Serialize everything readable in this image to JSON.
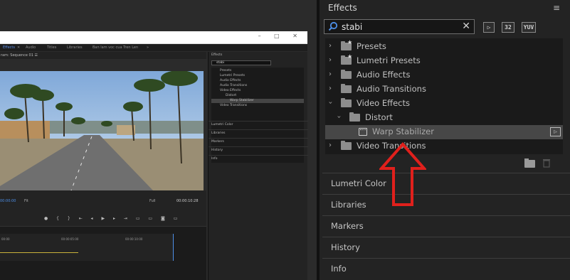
{
  "left_screenshot": {
    "workspace_tabs": [
      {
        "label": "Effects",
        "active": true
      },
      {
        "label": "Audio",
        "active": false
      },
      {
        "label": "Titles",
        "active": false
      },
      {
        "label": "Libraries",
        "active": false
      },
      {
        "label": "Ban lam voc cua Tren Len",
        "active": false
      },
      {
        "label": "»",
        "active": false
      }
    ],
    "program_header": "ram: Sequence 01 ☰",
    "timecode_left": "00:00:00",
    "fit_select": "Fit",
    "full_select": "Full",
    "timecode_right": "00:00:10:28",
    "timeline_ruler": [
      "00:00",
      "00:00:05:00",
      "00:00:10:00"
    ],
    "mini_effects": {
      "title": "Effects",
      "search": "stabi",
      "tree": [
        "Presets",
        "Lumetri Presets",
        "Audio Effects",
        "Audio Transitions",
        "Video Effects",
        "Distort",
        "Warp Stabilizer",
        "Video Transitions"
      ],
      "sections": [
        "Lumetri Color",
        "Libraries",
        "Markers",
        "History",
        "Info"
      ]
    }
  },
  "effects_panel": {
    "title": "Effects",
    "search": {
      "value": "stabi"
    },
    "filter_badges": [
      "32",
      "YUV"
    ],
    "tree": [
      {
        "label": "Presets",
        "expanded": false,
        "star": true
      },
      {
        "label": "Lumetri Presets",
        "expanded": false,
        "star": true
      },
      {
        "label": "Audio Effects",
        "expanded": false,
        "star": false
      },
      {
        "label": "Audio Transitions",
        "expanded": false,
        "star": false
      },
      {
        "label": "Video Effects",
        "expanded": true,
        "star": false
      },
      {
        "label": "Distort",
        "expanded": true,
        "star": false
      },
      {
        "label": "Warp Stabilizer",
        "selected": true
      },
      {
        "label": "Video Transitions",
        "expanded": false,
        "star": false
      }
    ],
    "sections": [
      "Lumetri Color",
      "Libraries",
      "Markers",
      "History",
      "Info"
    ]
  },
  "colors": {
    "panel_bg": "#232323",
    "tree_bg": "#1a1a1a",
    "selected_row": "#474747",
    "accent_blue": "#4d8fe8",
    "annotation_arrow": "#e0201c"
  }
}
